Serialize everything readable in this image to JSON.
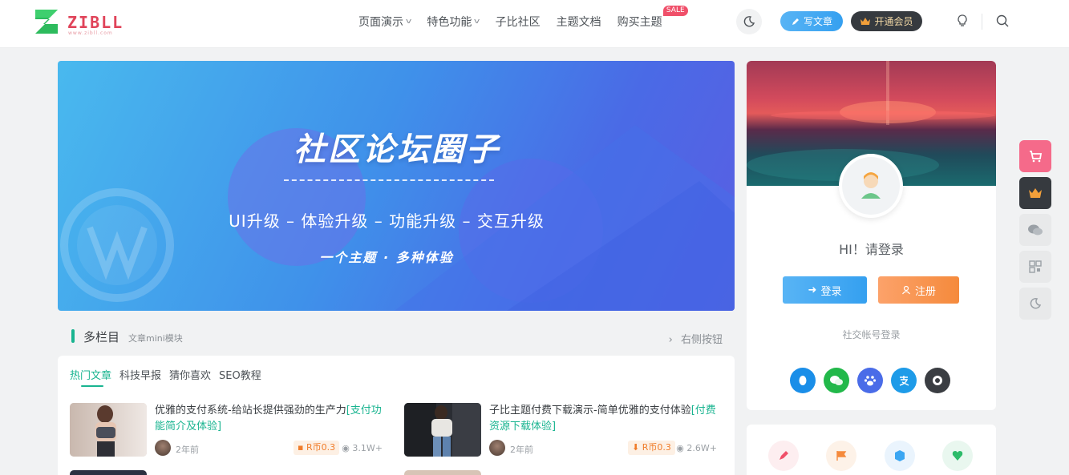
{
  "header": {
    "logo_text": "ZIBLL",
    "logo_sub": "www.zibll.com",
    "nav": [
      {
        "label": "页面演示",
        "has_dropdown": true
      },
      {
        "label": "特色功能",
        "has_dropdown": true
      },
      {
        "label": "子比社区",
        "has_dropdown": false
      },
      {
        "label": "主题文档",
        "has_dropdown": false
      },
      {
        "label": "购买主题",
        "has_dropdown": false,
        "badge": "SALE"
      }
    ],
    "write_label": "写文章",
    "vip_label": "开通会员"
  },
  "banner": {
    "title": "社区论坛圈子",
    "subtitle": "UI升级 – 体验升级 – 功能升级 – 交互升级",
    "tagline": "一个主题 · 多种体验"
  },
  "section": {
    "title": "多栏目",
    "subtitle": "文章mini模块",
    "right_button": "右侧按钮"
  },
  "tabs": [
    "热门文章",
    "科技早报",
    "猜你喜欢",
    "SEO教程"
  ],
  "posts": [
    {
      "title": "优雅的支付系统-给站长提供强劲的生产力",
      "highlight": "[支付功能简介及体验]",
      "time": "2年前",
      "price": "R币0.3",
      "views": "3.1W+"
    },
    {
      "title": "子比主题付费下载演示-简单优雅的支付体验",
      "highlight": "[付费资源下载体验]",
      "time": "2年前",
      "price": "R币0.3",
      "views": "2.6W+"
    }
  ],
  "user_card": {
    "greeting": "HI！请登录",
    "login_label": "登录",
    "register_label": "注册",
    "social_label": "社交帐号登录",
    "socials": [
      "qq-icon",
      "wechat-icon",
      "baidu-icon",
      "alipay-icon",
      "github-icon"
    ]
  },
  "colors": {
    "accent": "#19b490",
    "blue": "#3ba6f2",
    "orange": "#f58a3c",
    "dark": "#363a3f",
    "pink": "#f0506a"
  }
}
